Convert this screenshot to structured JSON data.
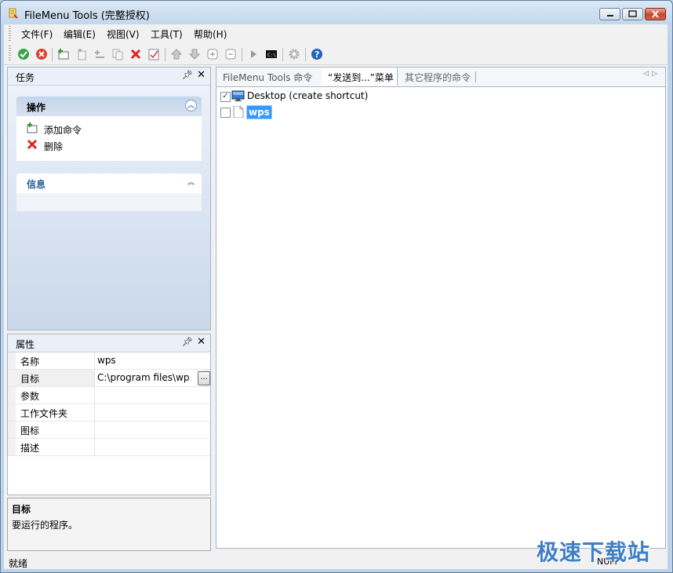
{
  "window": {
    "title": "FileMenu Tools (完整授权)"
  },
  "menubar": [
    "文件(F)",
    "编辑(E)",
    "视图(V)",
    "工具(T)",
    "帮助(H)"
  ],
  "toolbar": {
    "icons": [
      "apply-check-icon",
      "cancel-x-icon",
      "add-command-icon",
      "add-submenu-icon",
      "add-separator-icon",
      "copy-icon",
      "delete-icon",
      "select-all-icon",
      "move-up-icon",
      "move-down-icon",
      "expand-icon",
      "collapse-icon",
      "run-icon",
      "console-icon",
      "settings-gear-icon",
      "help-icon"
    ]
  },
  "tasks_pane": {
    "title": "任务",
    "actions_panel": {
      "title": "操作",
      "items": [
        "添加命令",
        "删除"
      ]
    },
    "info_panel": {
      "title": "信息"
    }
  },
  "properties_pane": {
    "title": "属性",
    "rows": [
      {
        "name": "名称",
        "value": "wps"
      },
      {
        "name": "目标",
        "value": "C:\\program files\\wps"
      },
      {
        "name": "参数",
        "value": ""
      },
      {
        "name": "工作文件夹",
        "value": ""
      },
      {
        "name": "图标",
        "value": ""
      },
      {
        "name": "描述",
        "value": ""
      }
    ],
    "browse_label": "..."
  },
  "description": {
    "title": "目标",
    "text": "要运行的程序。"
  },
  "tabs": [
    "FileMenu Tools 命令",
    "“发送到...”菜单",
    "其它程序的命令"
  ],
  "list_items": [
    {
      "label": "Desktop (create shortcut)",
      "checked": true,
      "selected": false
    },
    {
      "label": "wps",
      "checked": false,
      "selected": true
    }
  ],
  "statusbar": {
    "text": "就绪",
    "num": "NUM"
  },
  "watermark": "极速下载站",
  "colors": {
    "selection": "#3399ff",
    "panel_header": "#c4d5eb",
    "watermark": "#3f7fc6"
  }
}
